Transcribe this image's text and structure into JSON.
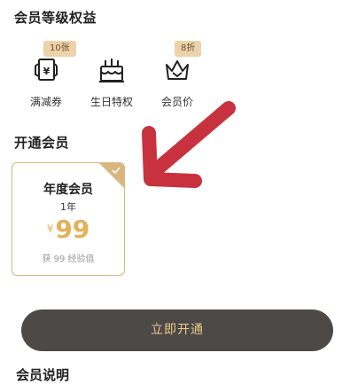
{
  "benefits_section": {
    "title": "会员等级权益",
    "items": [
      {
        "label": "满减券",
        "badge": "10张",
        "icon": "coupon-icon"
      },
      {
        "label": "生日特权",
        "badge": "",
        "icon": "birthday-cake-icon"
      },
      {
        "label": "会员价",
        "badge": "8折",
        "icon": "crown-icon"
      }
    ]
  },
  "membership_section": {
    "title": "开通会员",
    "plan": {
      "name": "年度会员",
      "period": "1年",
      "currency": "¥",
      "price": "99",
      "note": "获 99 经验值",
      "selected": true
    }
  },
  "cta": {
    "label": "立即开通"
  },
  "next_section": {
    "title": "会员说明"
  },
  "colors": {
    "gold": "#d9b67e",
    "price_gold": "#e2b25a",
    "badge_bg": "#ecd3a9",
    "button_bg": "#4d4946",
    "button_text": "#ecc98e",
    "annotation_arrow": "#c8323e"
  }
}
